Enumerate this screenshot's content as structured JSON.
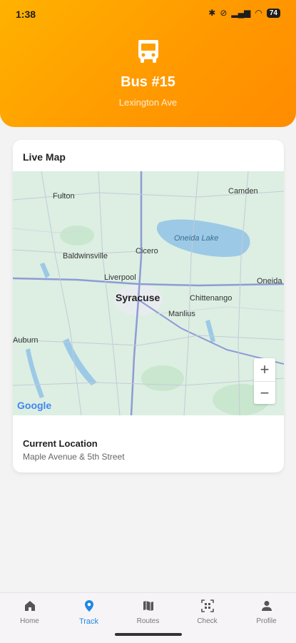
{
  "status": {
    "time": "1:38",
    "battery": "74"
  },
  "header": {
    "icon": "bus-icon",
    "title": "Bus #15",
    "subtitle": "Lexington Ave"
  },
  "card": {
    "title": "Live Map",
    "map": {
      "labels": {
        "fulton": "Fulton",
        "camden": "Camden",
        "oneida_lake": "Oneida Lake",
        "baldwinsville": "Baldwinsville",
        "cicero": "Cicero",
        "liverpool": "Liverpool",
        "syracuse": "Syracuse",
        "chittenango": "Chittenango",
        "oneida": "Oneida",
        "manlius": "Manlius",
        "auburn": "Auburn"
      },
      "zoom_in": "+",
      "zoom_out": "−",
      "attribution": "Google"
    },
    "location_label": "Current Location",
    "location_value": "Maple Avenue & 5th Street"
  },
  "nav": {
    "items": [
      {
        "label": "Home",
        "icon": "home-icon"
      },
      {
        "label": "Track",
        "icon": "location-pin-icon"
      },
      {
        "label": "Routes",
        "icon": "map-icon"
      },
      {
        "label": "Check",
        "icon": "qr-scan-icon"
      },
      {
        "label": "Profile",
        "icon": "person-icon"
      }
    ],
    "active": "Track"
  },
  "colors": {
    "header_start": "#ffb200",
    "header_end": "#ff8c00",
    "active_nav": "#1e88e5",
    "map_land": "#dcefe2",
    "map_water": "#9cc9e6"
  }
}
